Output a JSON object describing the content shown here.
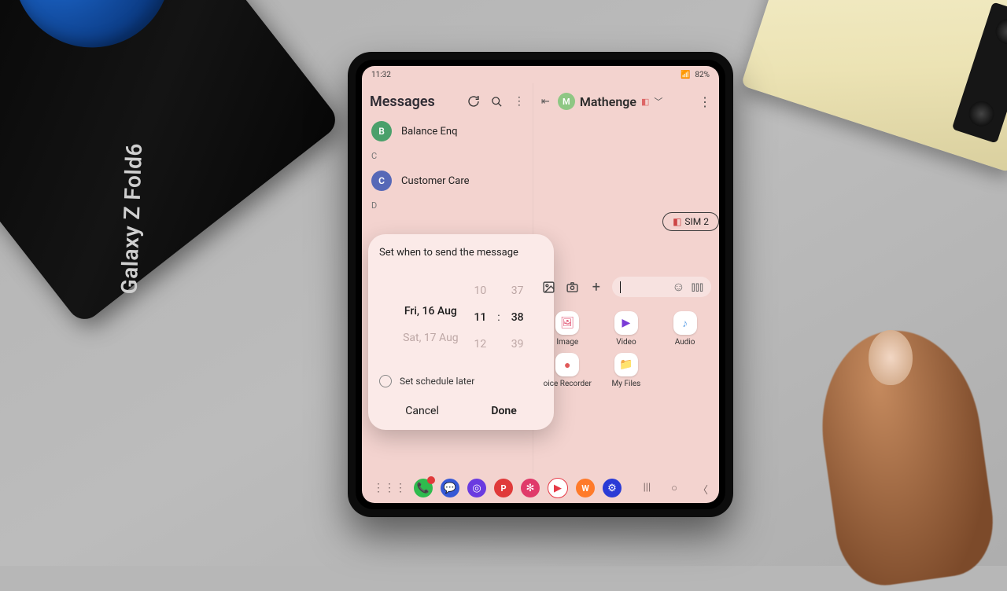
{
  "status": {
    "time": "11:32",
    "indicators": "◧ ⋯",
    "battery": "82%",
    "signal": "📶"
  },
  "left": {
    "title": "Messages",
    "items": [
      {
        "sec": null,
        "initial": "B",
        "color": "#4aa06b",
        "name": "Balance Enq"
      },
      {
        "sec": "C",
        "initial": "C",
        "color": "#5668b7",
        "name": "Customer Care"
      },
      {
        "sec": "D",
        "initial": "",
        "color": "",
        "name": ""
      }
    ]
  },
  "right": {
    "contact": {
      "initial": "M",
      "color": "#8ec784",
      "name": "Mathenge"
    },
    "sim": "SIM 2",
    "attachments": [
      {
        "label": "Image",
        "color": "#e04a6b",
        "glyph": "🖼"
      },
      {
        "label": "Video",
        "color": "#7a3bd6",
        "glyph": "▶"
      },
      {
        "label": "Audio",
        "color": "#6aa8e8",
        "glyph": "♪"
      },
      {
        "label": "oice Recorder",
        "color": "#e05a5a",
        "glyph": "●"
      },
      {
        "label": "My Files",
        "color": "#e89b2c",
        "glyph": "📁"
      },
      {
        "label": "",
        "color": "",
        "glyph": ""
      }
    ]
  },
  "dialog": {
    "title": "Set when to send the message",
    "date_prev": "",
    "date_sel": "Fri, 16 Aug",
    "date_next": "Sat, 17 Aug",
    "hour_prev": "10",
    "hour_sel": "11",
    "hour_next": "12",
    "min_prev": "37",
    "min_sel": "38",
    "min_next": "39",
    "schedule_later": "Set schedule later",
    "cancel": "Cancel",
    "done": "Done"
  },
  "taskbar": [
    {
      "bg": "#2fbb4e",
      "g": "📞"
    },
    {
      "bg": "#3659d6",
      "g": "💬"
    },
    {
      "bg": "#6a3be0",
      "g": "◎"
    },
    {
      "bg": "#e03a3a",
      "g": "P"
    },
    {
      "bg": "#e03a6a",
      "g": "✻"
    },
    {
      "bg": "#e63946",
      "g": "▶"
    },
    {
      "bg": "#ff7a2a",
      "g": "W"
    },
    {
      "bg": "#2a3bd6",
      "g": "⚙"
    }
  ],
  "box": {
    "label": "Galaxy Z Fold6"
  }
}
